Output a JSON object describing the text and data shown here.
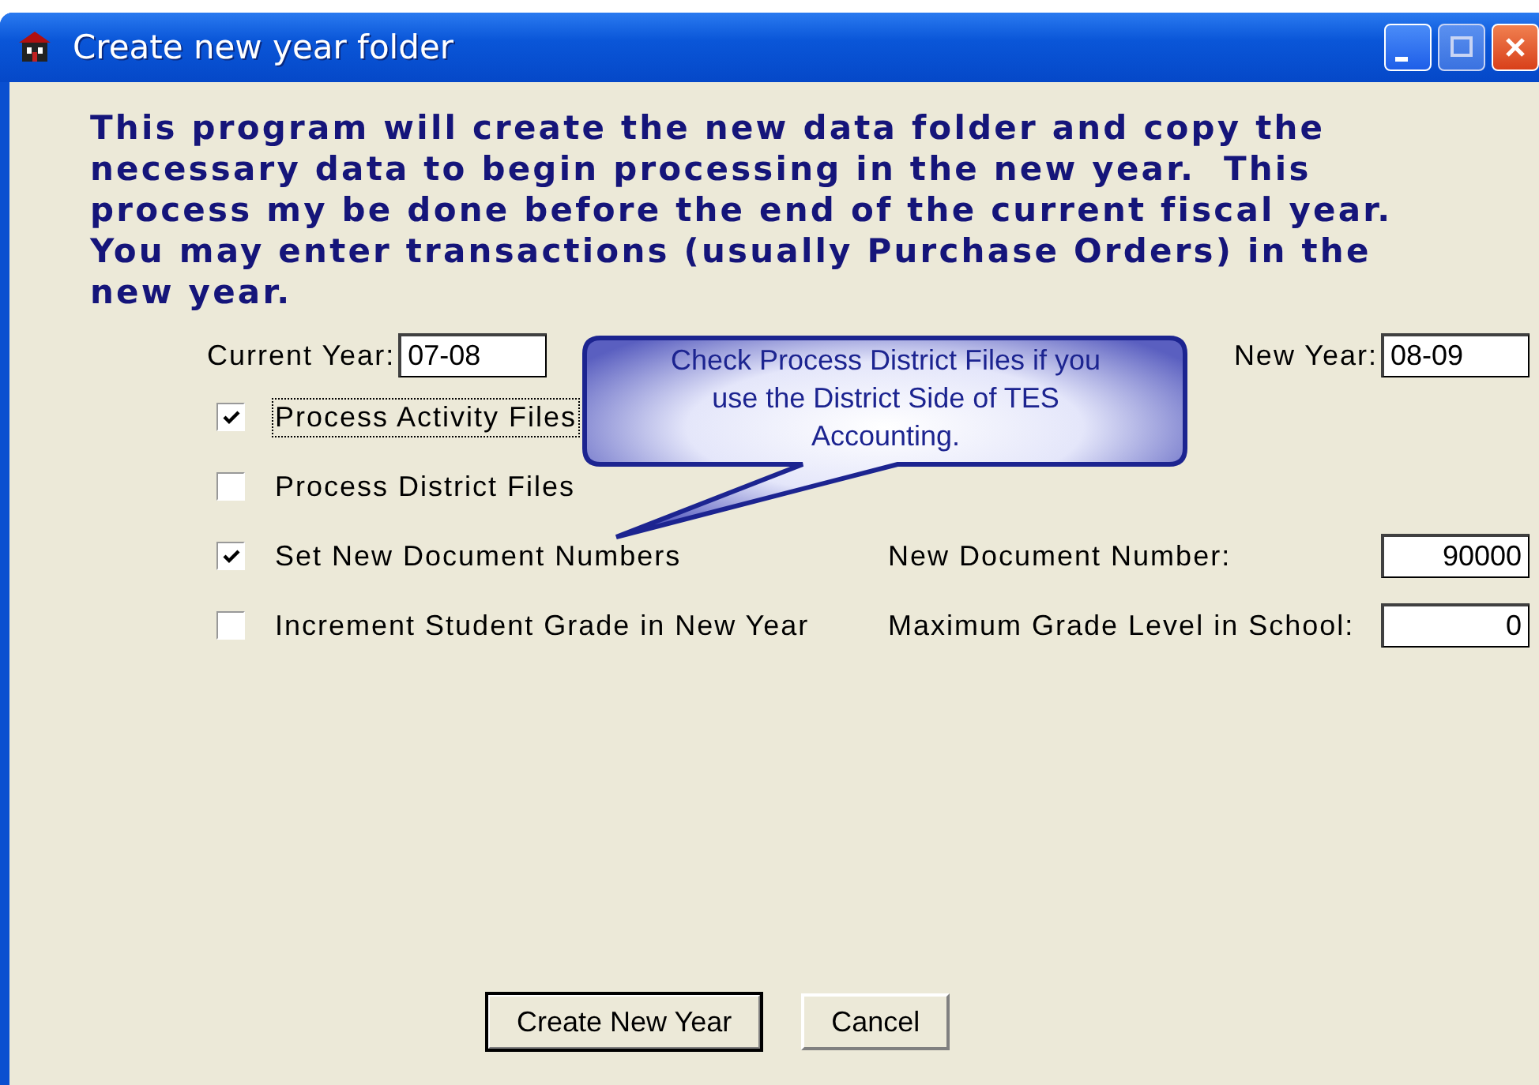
{
  "window": {
    "title": "Create new year folder"
  },
  "intro": "This program will create the new data folder and copy the necessary data to begin processing in the new year.  This process my be done before the end of the current fiscal year. You may enter transactions (usually Purchase Orders) in the new year.",
  "current_year": {
    "label": "Current Year:",
    "value": "07-08"
  },
  "new_year": {
    "label": "New Year:",
    "value": "08-09"
  },
  "options": [
    {
      "label": "Process Activity Files",
      "checked": true,
      "focused": true
    },
    {
      "label": "Process District Files",
      "checked": false,
      "focused": false
    },
    {
      "label": "Set New Document Numbers",
      "checked": true,
      "focused": false,
      "field": {
        "label": "New Document Number:",
        "value": "90000"
      }
    },
    {
      "label": "Increment Student Grade  in New Year",
      "checked": false,
      "focused": false,
      "field": {
        "label": "Maximum Grade Level in School:",
        "value": "0"
      }
    }
  ],
  "callout": "Check Process District Files if you use the District Side of TES Accounting.",
  "buttons": [
    {
      "label": "Create New Year",
      "default": true
    },
    {
      "label": "Cancel",
      "default": false
    }
  ]
}
